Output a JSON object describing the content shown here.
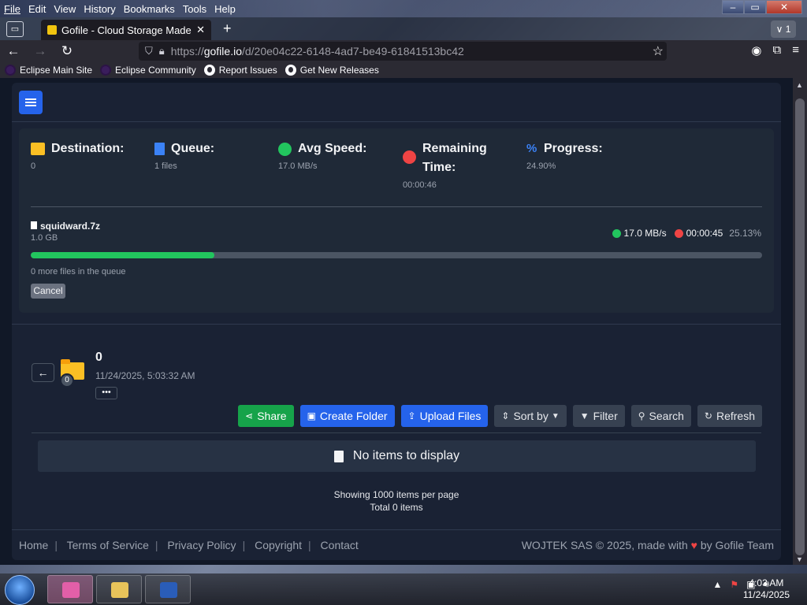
{
  "menu": [
    "File",
    "Edit",
    "View",
    "History",
    "Bookmarks",
    "Tools",
    "Help"
  ],
  "window_controls": {
    "minimize": "–",
    "maximize": "▭",
    "close": "✕"
  },
  "tab": {
    "title": "Gofile - Cloud Storage Made Sir",
    "close": "✕",
    "new_tab": "+",
    "count": "∨ 1"
  },
  "nav": {
    "back": "←",
    "forward": "→",
    "reload": "↻",
    "url_prefix": "https://",
    "url_host": "gofile.io",
    "url_path": "/d/20e04c22-6148-4ad7-be49-61841513bc42"
  },
  "bookmarks": [
    "Eclipse Main Site",
    "Eclipse Community",
    "Report Issues",
    "Get New Releases"
  ],
  "upload": {
    "destination": {
      "label": "Destination:",
      "value": "0"
    },
    "queue": {
      "label": "Queue:",
      "value": "1 files"
    },
    "avg_speed": {
      "label": "Avg Speed:",
      "value": "17.0 MB/s"
    },
    "remaining": {
      "label": "Remaining",
      "label2": "Time:",
      "value": "00:00:46"
    },
    "progress": {
      "label": "Progress:",
      "value": "24.90%"
    },
    "file": {
      "name": "squidward.7z",
      "size": "1.0 GB",
      "speed": "17.0 MB/s",
      "eta": "00:00:45",
      "percent_text": "25.13%",
      "percent": 25.13
    },
    "queue_more": "0 more files in the queue",
    "cancel": "Cancel"
  },
  "folder": {
    "back": "←",
    "badge": "0",
    "name": "0",
    "date": "11/24/2025, 5:03:32 AM",
    "more": "•••"
  },
  "actions": {
    "share": "Share",
    "create_folder": "Create Folder",
    "upload_files": "Upload Files",
    "sort_by": "Sort by",
    "filter": "Filter",
    "search": "Search",
    "refresh": "Refresh"
  },
  "empty": {
    "text": "No items to display"
  },
  "listing": {
    "per_page": "Showing 1000 items per page",
    "total": "Total 0 items"
  },
  "footer": {
    "links": [
      "Home",
      "Terms of Service",
      "Privacy Policy",
      "Copyright",
      "Contact"
    ],
    "credit_prefix": "WOJTEK SAS © 2025, made with",
    "credit_suffix": "by Gofile Team"
  },
  "taskbar": {
    "time": "4:03 AM",
    "date": "11/24/2025"
  },
  "colors": {
    "accent": "#2563eb",
    "success": "#16a34a",
    "page_bg": "#111827",
    "panel_bg": "#1f2937"
  }
}
